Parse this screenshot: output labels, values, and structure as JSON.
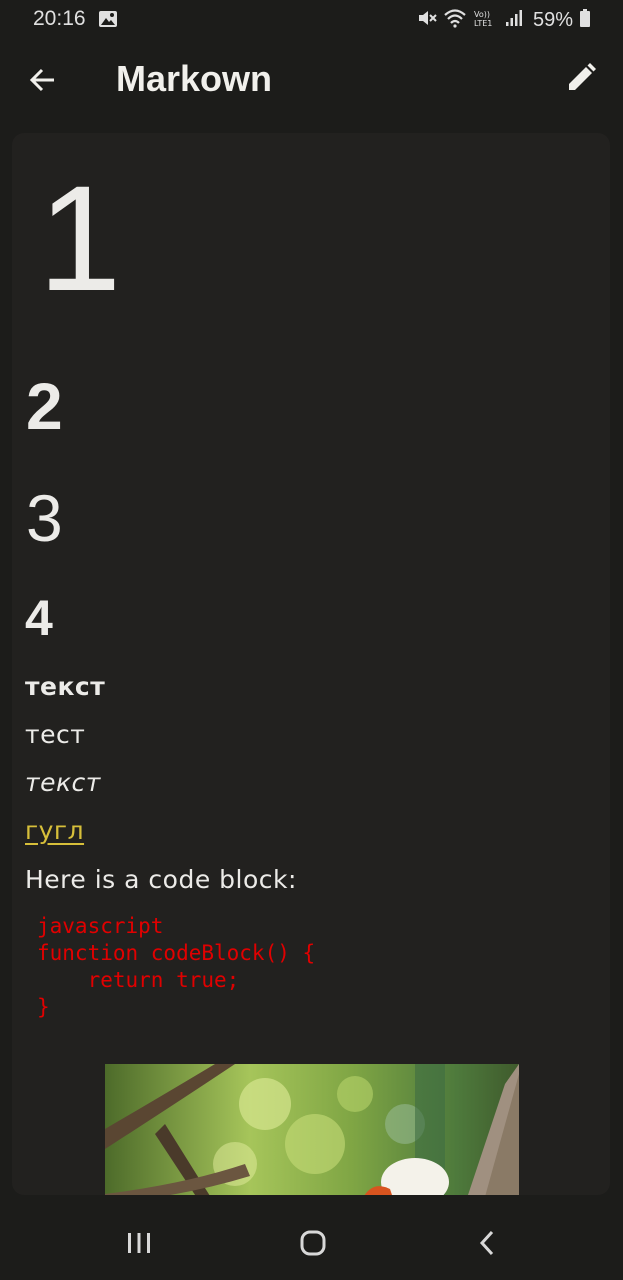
{
  "status_bar": {
    "time": "20:16",
    "battery": "59%",
    "icons": [
      "gallery-icon",
      "mute-icon",
      "wifi-icon",
      "volte-icon",
      "signal-icon",
      "battery-icon"
    ]
  },
  "app_bar": {
    "title": "Markown",
    "back_icon": "arrow-left-icon",
    "edit_icon": "pencil-icon"
  },
  "content": {
    "h1": "1",
    "h2": "2",
    "h3": "3",
    "h4": "4",
    "bold_text": "текст",
    "normal_text": "тест",
    "italic_text": "текст",
    "link_text": "гугл",
    "code_intro": "Here is a code block:",
    "code_lines": [
      "javascript",
      "function codeBlock() {",
      "    return true;",
      "}"
    ],
    "image": "photo-image"
  },
  "colors": {
    "background": "#1c1c1a",
    "card": "#22211f",
    "text": "#ecebe8",
    "link": "#d7bf3a",
    "code": "#e10000"
  },
  "nav_bar": {
    "icons": [
      "recent-apps-icon",
      "home-icon",
      "back-nav-icon"
    ]
  }
}
